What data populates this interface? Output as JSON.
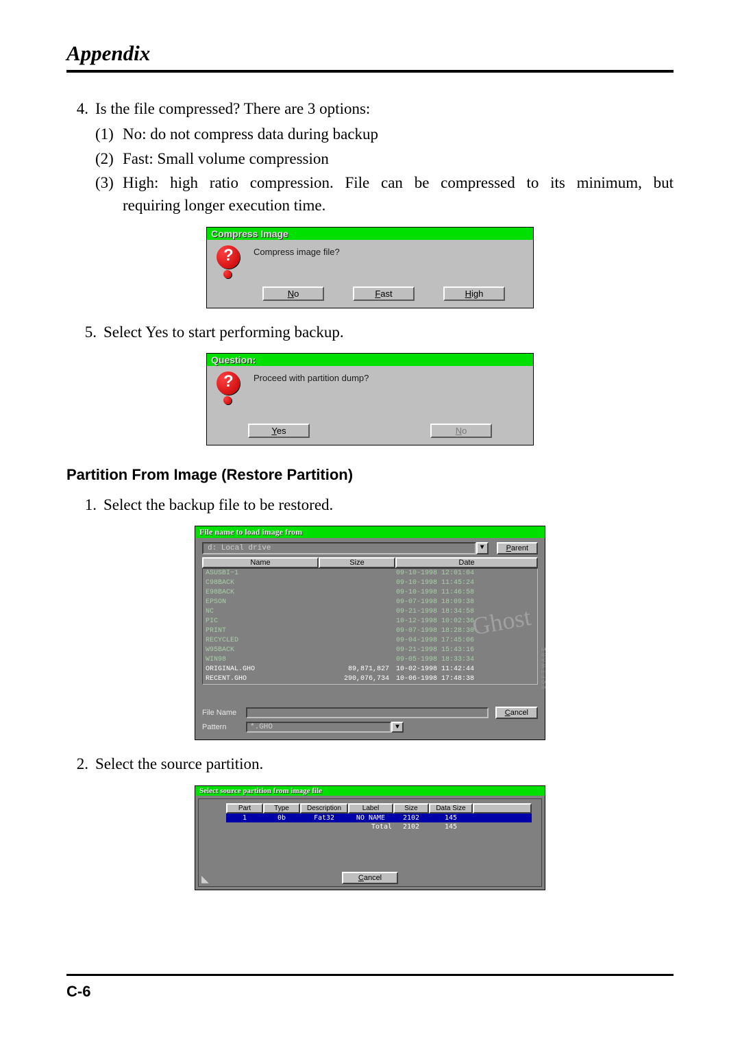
{
  "page": {
    "title": "Appendix",
    "footer": "C-6"
  },
  "item4": {
    "num": "4.",
    "text": "Is the file compressed? There are 3 options:",
    "opts": [
      {
        "p": "(1)",
        "t": "No: do not compress data during backup"
      },
      {
        "p": "(2)",
        "t": "Fast: Small volume compression"
      },
      {
        "p": "(3)",
        "t1": "High: high ratio compression.  File can be compressed to its minimum, but",
        "t2": "requiring longer execution time."
      }
    ]
  },
  "dlg_compress": {
    "title": "Compress Image",
    "text": "Compress image file?",
    "btns": {
      "no": {
        "u": "N",
        "rest": "o"
      },
      "fast": {
        "u": "F",
        "rest": "ast"
      },
      "high": {
        "u": "H",
        "rest": "igh"
      }
    }
  },
  "item5": {
    "num": "5.",
    "text": "Select Yes to start performing backup."
  },
  "dlg_question": {
    "title": "Question:",
    "text": "Proceed with partition dump?",
    "btns": {
      "yes": {
        "u": "Y",
        "rest": "es"
      },
      "no": {
        "u": "N",
        "rest": "o"
      }
    }
  },
  "section_h": "Partition From Image (Restore Partition)",
  "restore1": {
    "num": "1.",
    "text": "Select the backup file to be restored."
  },
  "file_dialog": {
    "title": "File name to load image from",
    "drive": "d: Local drive",
    "btn_parent": {
      "u": "P",
      "rest": "arent"
    },
    "headers": {
      "name": "Name",
      "size": "Size",
      "date": "Date"
    },
    "rows": [
      {
        "name": "ASUSBI~1",
        "size": "",
        "date": "09-10-1998 12:01:04",
        "cls": ""
      },
      {
        "name": "C98BACK",
        "size": "",
        "date": "09-10-1998 11:45:24",
        "cls": ""
      },
      {
        "name": "E98BACK",
        "size": "",
        "date": "09-10-1998 11:46:58",
        "cls": ""
      },
      {
        "name": "EPSON",
        "size": "",
        "date": "09-07-1998 18:09:38",
        "cls": ""
      },
      {
        "name": "NC",
        "size": "",
        "date": "09-21-1998 18:34:58",
        "cls": ""
      },
      {
        "name": "PIC",
        "size": "",
        "date": "10-12-1998 10:02:36",
        "cls": ""
      },
      {
        "name": "PRINT",
        "size": "",
        "date": "09-07-1998 18:28:30",
        "cls": ""
      },
      {
        "name": "RECYCLED",
        "size": "",
        "date": "09-04-1998 17:45:06",
        "cls": ""
      },
      {
        "name": "W95BACK",
        "size": "",
        "date": "09-21-1998 15:43:16",
        "cls": ""
      },
      {
        "name": "WIN98",
        "size": "",
        "date": "09-05-1998 18:33:34",
        "cls": ""
      },
      {
        "name": "ORIGINAL.GHO",
        "size": "89,871,827",
        "date": "10-02-1998 11:42:44",
        "cls": "white"
      },
      {
        "name": "RECENT.GHO",
        "size": "290,076,734",
        "date": "10-06-1998 17:48:38",
        "cls": "white"
      }
    ],
    "file_name_lbl": "File Name",
    "pattern_lbl": "Pattern",
    "pattern_val": "*.GHO",
    "btn_cancel": {
      "u": "C",
      "rest": "ancel"
    },
    "logo": "Ghost",
    "logo_sub": "SOFTWARE"
  },
  "restore2": {
    "num": "2.",
    "text": "Select the source partition."
  },
  "part_dialog": {
    "title": "Select source partition from image file",
    "headers": [
      "Part",
      "Type",
      "Description",
      "Label",
      "Size",
      "Data Size"
    ],
    "row": {
      "part": "1",
      "type": "0b",
      "desc": "Fat32",
      "label": "NO NAME",
      "size": "2102",
      "dsize": "145"
    },
    "total_row": {
      "label": "Total",
      "size": "2102",
      "dsize": "145"
    },
    "btn_cancel": {
      "u": "C",
      "rest": "ancel"
    }
  }
}
